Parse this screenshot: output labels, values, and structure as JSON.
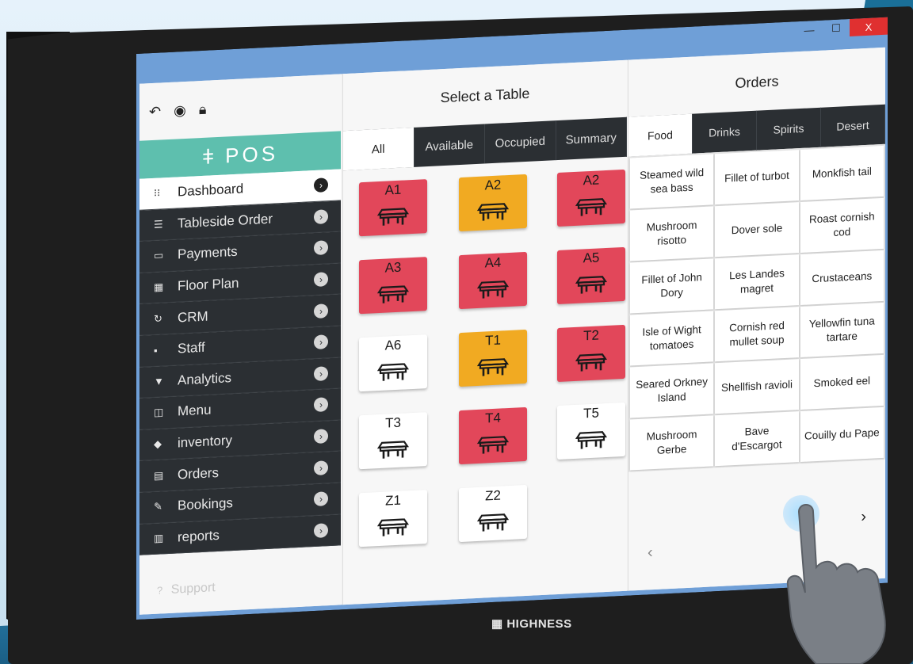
{
  "window": {
    "controls": [
      "—",
      "☐",
      "X"
    ]
  },
  "sidebar": {
    "logo": "POS",
    "items": [
      {
        "label": "Dashboard",
        "icon": "grid-icon",
        "glyph": "⁝⁝"
      },
      {
        "label": "Tableside Order",
        "icon": "sliders-icon",
        "glyph": "☰"
      },
      {
        "label": "Payments",
        "icon": "card-icon",
        "glyph": "▭"
      },
      {
        "label": "Floor Plan",
        "icon": "floorplan-icon",
        "glyph": "▦"
      },
      {
        "label": "CRM",
        "icon": "sync-icon",
        "glyph": "↻"
      },
      {
        "label": "Staff",
        "icon": "id-badge-icon",
        "glyph": "▪"
      },
      {
        "label": "Analytics",
        "icon": "filter-icon",
        "glyph": "▼"
      },
      {
        "label": "Menu",
        "icon": "book-icon",
        "glyph": "◫"
      },
      {
        "label": "inventory",
        "icon": "box-icon",
        "glyph": "◆"
      },
      {
        "label": "Orders",
        "icon": "clipboard-icon",
        "glyph": "▤"
      },
      {
        "label": "Bookings",
        "icon": "pencil-icon",
        "glyph": "✎"
      },
      {
        "label": "reports",
        "icon": "document-icon",
        "glyph": "▥"
      }
    ],
    "support": "Support"
  },
  "tables_panel": {
    "title": "Select a Table",
    "tabs": [
      "All",
      "Available",
      "Occupied",
      "Summary"
    ],
    "tables": [
      {
        "label": "A1",
        "status": "red"
      },
      {
        "label": "A2",
        "status": "orange"
      },
      {
        "label": "A2",
        "status": "red"
      },
      {
        "label": "A3",
        "status": "red"
      },
      {
        "label": "A4",
        "status": "red"
      },
      {
        "label": "A5",
        "status": "red"
      },
      {
        "label": "A6",
        "status": "white"
      },
      {
        "label": "T1",
        "status": "orange"
      },
      {
        "label": "T2",
        "status": "red"
      },
      {
        "label": "T3",
        "status": "white"
      },
      {
        "label": "T4",
        "status": "red"
      },
      {
        "label": "T5",
        "status": "white"
      },
      {
        "label": "Z1",
        "status": "white"
      },
      {
        "label": "Z2",
        "status": "white"
      }
    ]
  },
  "orders_panel": {
    "title": "Orders",
    "tabs": [
      "Food",
      "Drinks",
      "Spirits",
      "Desert"
    ],
    "items": [
      "Steamed wild sea bass",
      "Fillet of turbot",
      "Monkfish tail",
      "Mushroom risotto",
      "Dover sole",
      "Roast cornish cod",
      "Fillet of John Dory",
      "Les Landes magret",
      "Crustaceans",
      "Isle of Wight tomatoes",
      "Cornish red mullet soup",
      "Yellowfin tuna tartare",
      "Seared Orkney Island",
      "Shellfish ravioli",
      "Smoked eel",
      "Mushroom Gerbe",
      "Bave d'Escargot",
      "Couilly du Pape"
    ],
    "prev": "‹",
    "next": "›"
  },
  "brand": "HIGHNESS",
  "colors": {
    "occupied": "#e2475a",
    "reserved": "#f1aa22",
    "available": "#ffffff",
    "logo": "#5ebfae",
    "nav": "#2b2f33"
  }
}
